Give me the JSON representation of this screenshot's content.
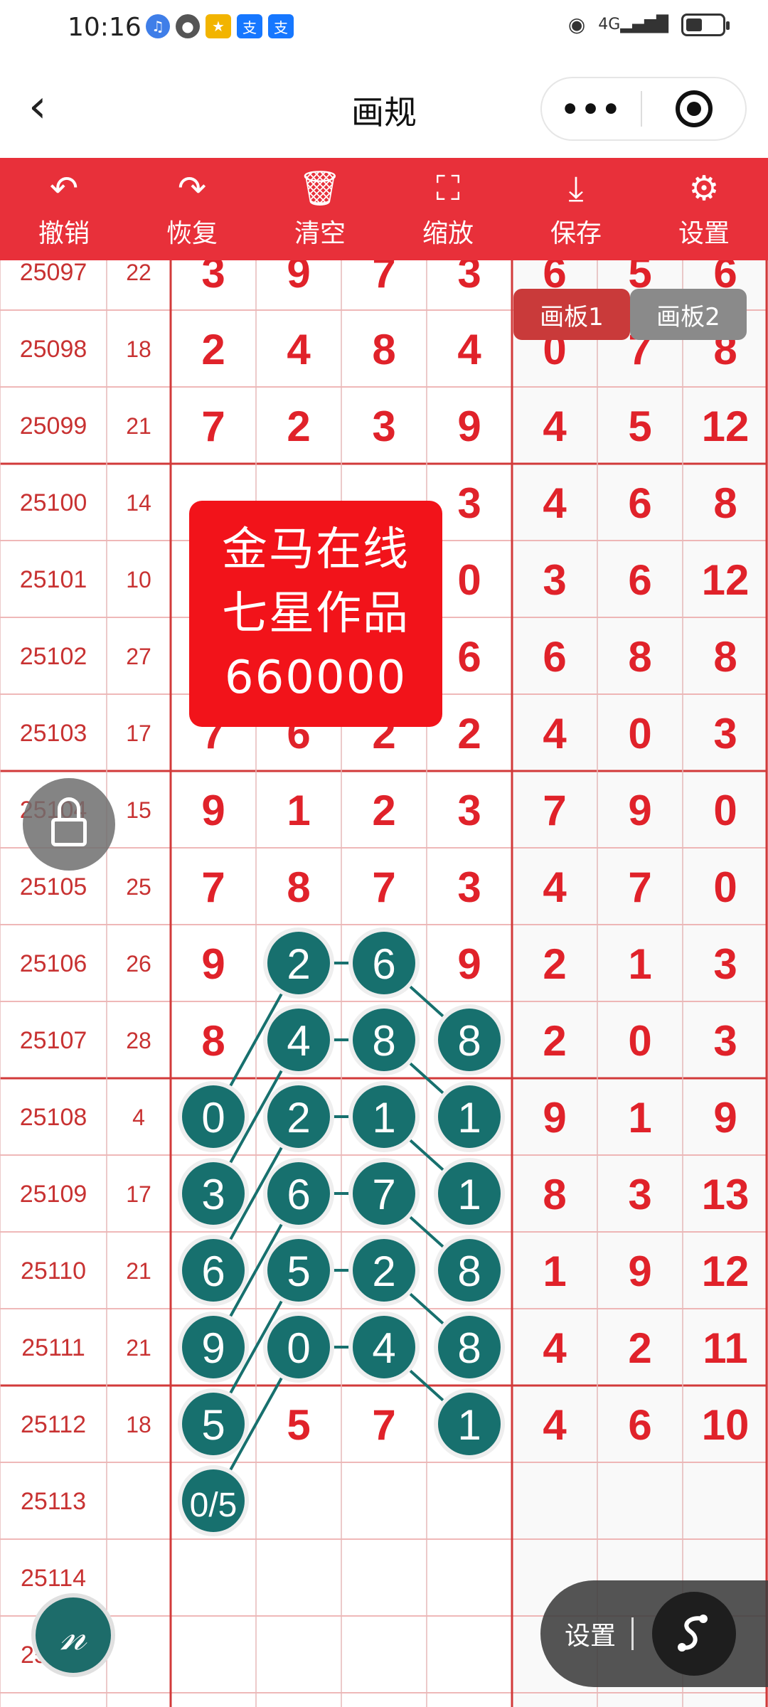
{
  "status": {
    "time": "10:16",
    "network": "4G"
  },
  "header": {
    "title": "画规",
    "back_icon": "chevron-left-icon",
    "more_icon": "more-dots-icon",
    "target_icon": "target-icon"
  },
  "toolbar": {
    "items": [
      {
        "label": "撤销",
        "icon": "undo-icon"
      },
      {
        "label": "恢复",
        "icon": "redo-icon"
      },
      {
        "label": "清空",
        "icon": "trash-icon"
      },
      {
        "label": "缩放",
        "icon": "zoom-icon"
      },
      {
        "label": "保存",
        "icon": "download-icon"
      },
      {
        "label": "设置",
        "icon": "gear-icon"
      }
    ]
  },
  "board_tabs": {
    "tab1": "画板1",
    "tab2": "画板2"
  },
  "overlay": {
    "line1": "金马在线",
    "line2": "七星作品",
    "line3": "660000"
  },
  "rows": [
    {
      "id": "25097",
      "sum": "22",
      "d": [
        "3",
        "9",
        "7",
        "3",
        "6",
        "5",
        "6"
      ]
    },
    {
      "id": "25098",
      "sum": "18",
      "d": [
        "2",
        "4",
        "8",
        "4",
        "0",
        "7",
        "8"
      ]
    },
    {
      "id": "25099",
      "sum": "21",
      "d": [
        "7",
        "2",
        "3",
        "9",
        "4",
        "5",
        "12"
      ]
    },
    {
      "id": "25100",
      "sum": "14",
      "d": [
        "",
        "",
        "",
        "3",
        "4",
        "6",
        "8"
      ]
    },
    {
      "id": "25101",
      "sum": "10",
      "d": [
        "",
        "",
        "",
        "0",
        "3",
        "6",
        "12"
      ]
    },
    {
      "id": "25102",
      "sum": "27",
      "d": [
        "",
        "",
        "",
        "6",
        "6",
        "8",
        "8"
      ]
    },
    {
      "id": "25103",
      "sum": "17",
      "d": [
        "7",
        "6",
        "2",
        "2",
        "4",
        "0",
        "3"
      ]
    },
    {
      "id": "25104",
      "sum": "15",
      "d": [
        "9",
        "1",
        "2",
        "3",
        "7",
        "9",
        "0"
      ]
    },
    {
      "id": "25105",
      "sum": "25",
      "d": [
        "7",
        "8",
        "7",
        "3",
        "4",
        "7",
        "0"
      ]
    },
    {
      "id": "25106",
      "sum": "26",
      "d": [
        "9",
        "2",
        "6",
        "9",
        "2",
        "1",
        "3"
      ]
    },
    {
      "id": "25107",
      "sum": "28",
      "d": [
        "8",
        "4",
        "8",
        "8",
        "2",
        "0",
        "3"
      ]
    },
    {
      "id": "25108",
      "sum": "4",
      "d": [
        "0",
        "2",
        "1",
        "1",
        "9",
        "1",
        "9"
      ]
    },
    {
      "id": "25109",
      "sum": "17",
      "d": [
        "3",
        "6",
        "7",
        "1",
        "8",
        "3",
        "13"
      ]
    },
    {
      "id": "25110",
      "sum": "21",
      "d": [
        "6",
        "5",
        "2",
        "8",
        "1",
        "9",
        "12"
      ]
    },
    {
      "id": "25111",
      "sum": "21",
      "d": [
        "9",
        "0",
        "4",
        "8",
        "4",
        "2",
        "11"
      ]
    },
    {
      "id": "25112",
      "sum": "18",
      "d": [
        "5",
        "5",
        "7",
        "1",
        "4",
        "6",
        "10"
      ]
    },
    {
      "id": "25113",
      "sum": "",
      "d": [
        "0/5",
        "",
        "",
        "",
        "",
        "",
        ""
      ]
    },
    {
      "id": "25114",
      "sum": "",
      "d": [
        "",
        "",
        "",
        "",
        "",
        "",
        ""
      ]
    },
    {
      "id": "25115",
      "sum": "",
      "d": [
        "",
        "",
        "",
        "",
        "",
        "",
        ""
      ]
    }
  ],
  "circled": [
    [
      9,
      1
    ],
    [
      9,
      2
    ],
    [
      10,
      1
    ],
    [
      10,
      2
    ],
    [
      10,
      3
    ],
    [
      11,
      0
    ],
    [
      11,
      1
    ],
    [
      11,
      2
    ],
    [
      11,
      3
    ],
    [
      12,
      0
    ],
    [
      12,
      1
    ],
    [
      12,
      2
    ],
    [
      12,
      3
    ],
    [
      13,
      0
    ],
    [
      13,
      1
    ],
    [
      13,
      2
    ],
    [
      13,
      3
    ],
    [
      14,
      0
    ],
    [
      14,
      1
    ],
    [
      14,
      2
    ],
    [
      14,
      3
    ],
    [
      15,
      0
    ],
    [
      15,
      3
    ],
    [
      16,
      0
    ]
  ],
  "connections": [
    [
      [
        9,
        1
      ],
      [
        9,
        2
      ]
    ],
    [
      [
        10,
        1
      ],
      [
        10,
        2
      ]
    ],
    [
      [
        11,
        1
      ],
      [
        11,
        2
      ]
    ],
    [
      [
        12,
        1
      ],
      [
        12,
        2
      ]
    ],
    [
      [
        13,
        1
      ],
      [
        13,
        2
      ]
    ],
    [
      [
        14,
        1
      ],
      [
        14,
        2
      ]
    ],
    [
      [
        9,
        1
      ],
      [
        11,
        0
      ]
    ],
    [
      [
        10,
        1
      ],
      [
        12,
        0
      ]
    ],
    [
      [
        11,
        1
      ],
      [
        13,
        0
      ]
    ],
    [
      [
        12,
        1
      ],
      [
        14,
        0
      ]
    ],
    [
      [
        13,
        1
      ],
      [
        15,
        0
      ]
    ],
    [
      [
        14,
        1
      ],
      [
        16,
        0
      ]
    ],
    [
      [
        9,
        2
      ],
      [
        10,
        3
      ]
    ],
    [
      [
        10,
        2
      ],
      [
        11,
        3
      ]
    ],
    [
      [
        11,
        2
      ],
      [
        12,
        3
      ]
    ],
    [
      [
        12,
        2
      ],
      [
        13,
        3
      ]
    ],
    [
      [
        13,
        2
      ],
      [
        14,
        3
      ]
    ],
    [
      [
        14,
        2
      ],
      [
        15,
        3
      ]
    ]
  ],
  "colors": {
    "brand_red": "#e8303a",
    "digit_red": "#e0222a",
    "circle_teal": "#17706e",
    "id_text": "#c83232"
  },
  "floating": {
    "settings_label": "设置",
    "lock_icon": "lock-icon",
    "pen_icon": "pen-icon",
    "share_icon": "share-icon"
  }
}
